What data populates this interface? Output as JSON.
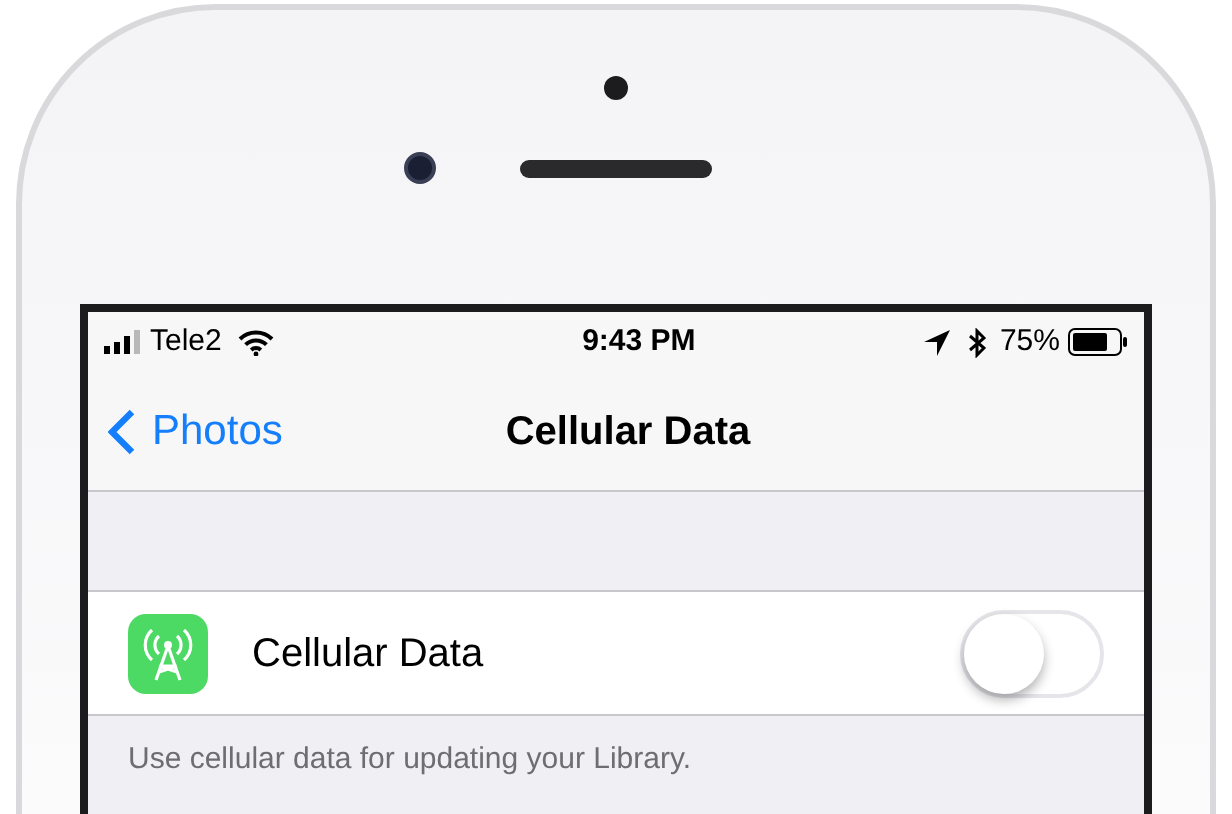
{
  "status_bar": {
    "carrier": "Tele2",
    "time": "9:43 PM",
    "battery": "75%"
  },
  "nav": {
    "back": "Photos",
    "title": "Cellular Data"
  },
  "settings": [
    {
      "label": "Cellular Data",
      "on": false
    }
  ],
  "footer": "Use cellular data for updating your Library."
}
